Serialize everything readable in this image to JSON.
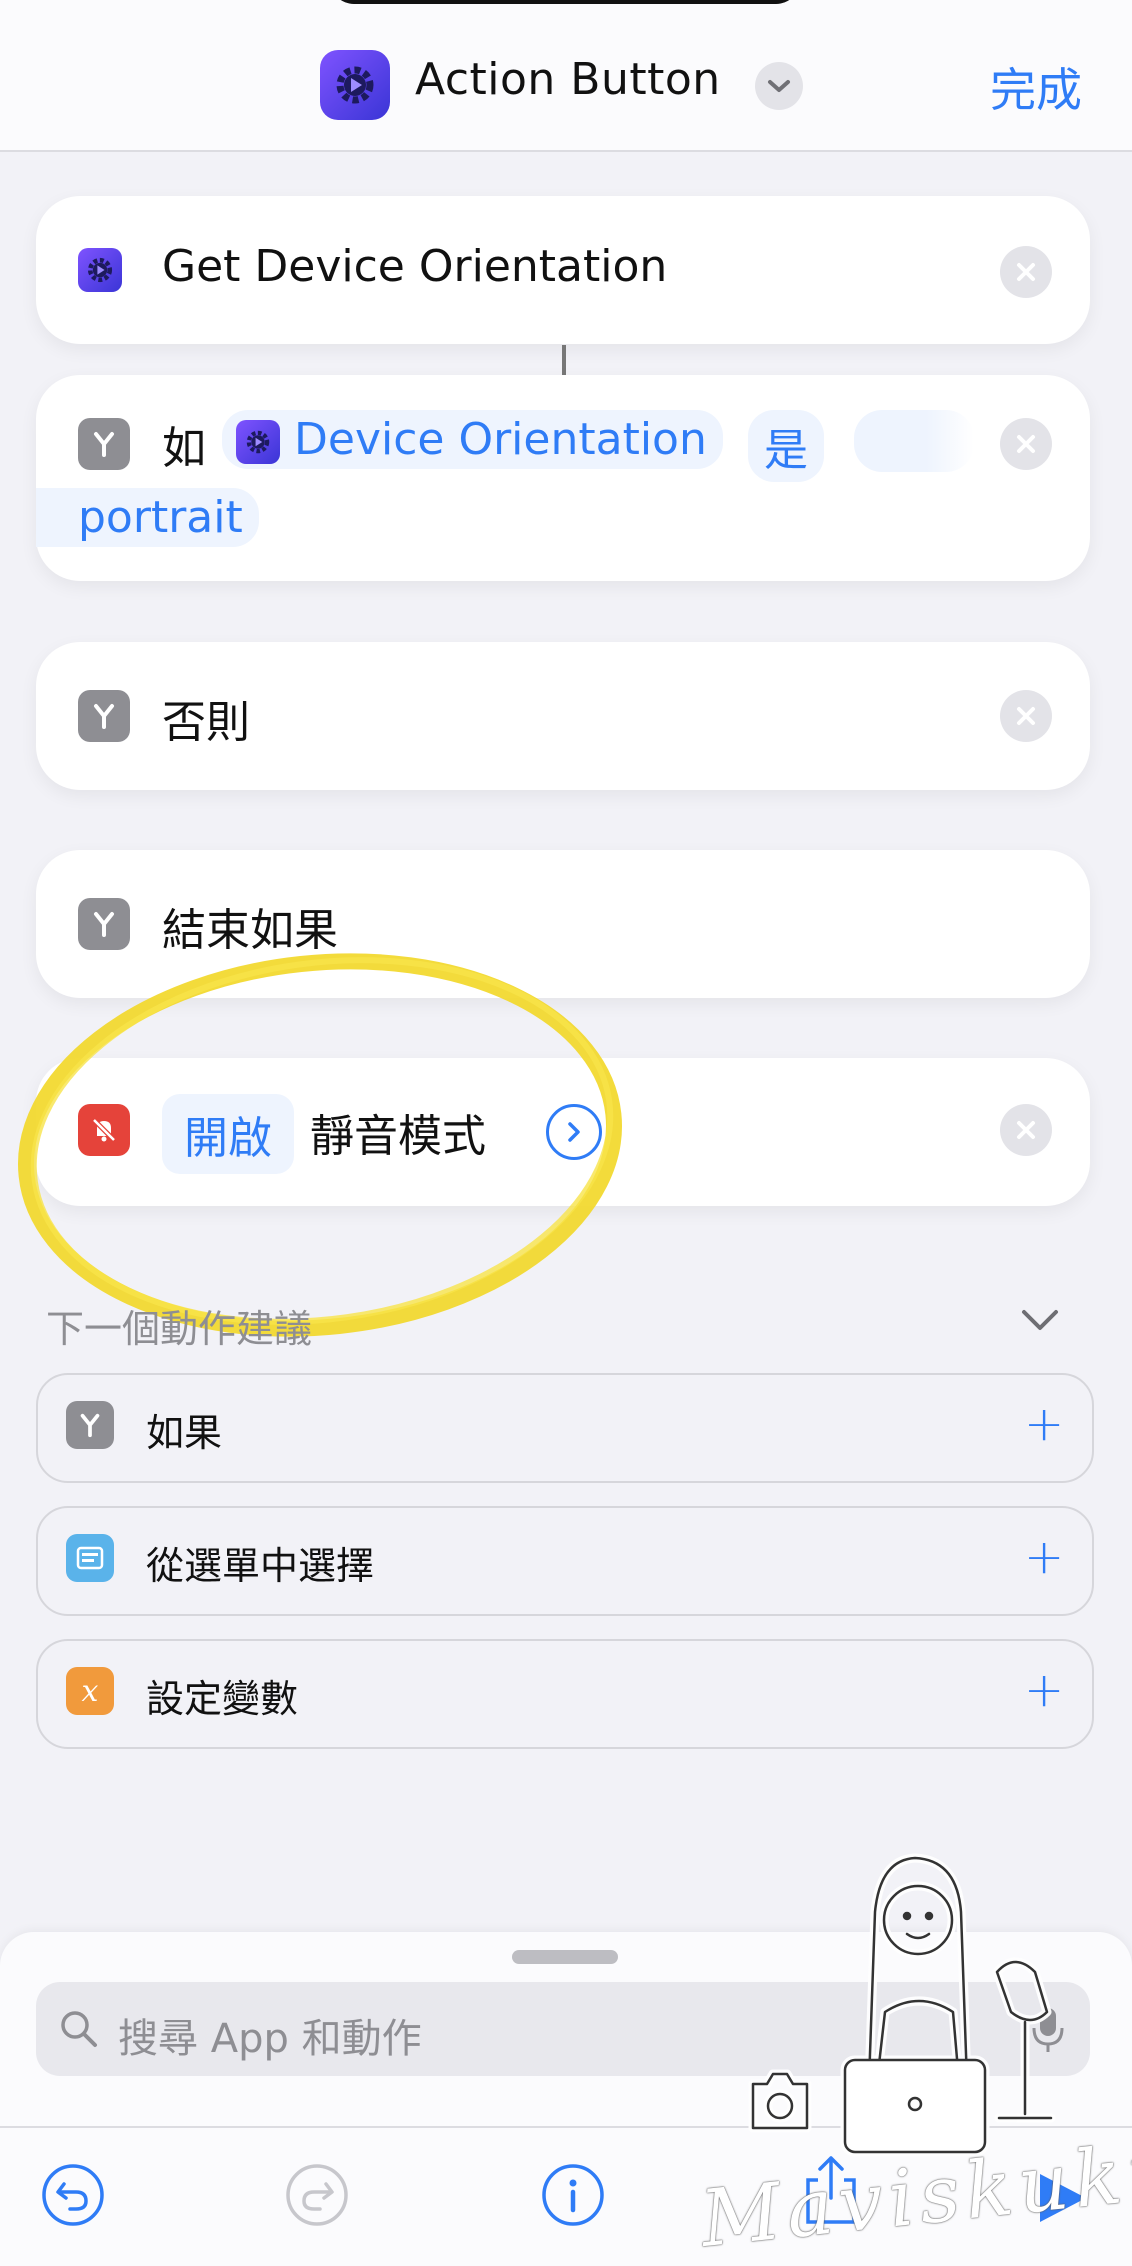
{
  "header": {
    "title": "Action Button",
    "done_label": "完成"
  },
  "actions": {
    "get_orientation": {
      "label": "Get Device Orientation"
    },
    "if_block": {
      "keyword": "如",
      "variable": "Device Orientation",
      "operator": "是",
      "value": "portrait"
    },
    "otherwise": {
      "label": "否則"
    },
    "end_if": {
      "label": "結束如果"
    },
    "silent_mode": {
      "toggle_value": "開啟",
      "label": "靜音模式"
    }
  },
  "suggestions": {
    "heading": "下一個動作建議",
    "items": [
      {
        "label": "如果",
        "icon": "branch-icon",
        "color": "#8e8e93"
      },
      {
        "label": "從選單中選擇",
        "icon": "menu-icon",
        "color": "#5ab3ea"
      },
      {
        "label": "設定變數",
        "icon": "variable-icon",
        "color": "#f19a3c"
      }
    ]
  },
  "search": {
    "placeholder": "搜尋 App 和動作"
  },
  "watermark": "Maviskuku",
  "colors": {
    "accent": "#2f7cf6",
    "shortcut_icon": "#5b3df0",
    "silent_icon": "#e5433a",
    "highlight_circle": "#f2d82a"
  }
}
